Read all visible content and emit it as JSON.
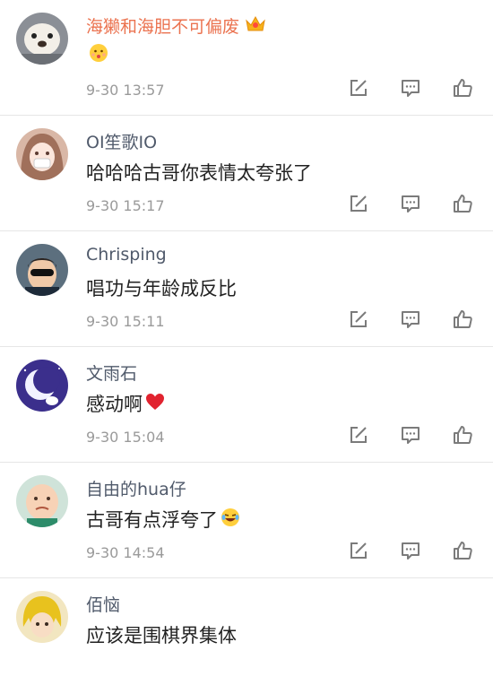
{
  "comments": [
    {
      "username": "海獭和海胆不可偏废",
      "vip": true,
      "text": "",
      "emoji": "kiss-emoji",
      "time": "9-30 13:57"
    },
    {
      "username": "OI笙歌IO",
      "vip": false,
      "text": "哈哈哈古哥你表情太夸张了",
      "emoji": "",
      "time": "9-30 15:17"
    },
    {
      "username": "Chrisping",
      "vip": false,
      "text": "唱功与年龄成反比",
      "emoji": "",
      "time": "9-30 15:11"
    },
    {
      "username": "文雨石",
      "vip": false,
      "text": "感动啊",
      "emoji": "heart-emoji",
      "time": "9-30 15:04"
    },
    {
      "username": "自由的hua仔",
      "vip": false,
      "text": "古哥有点浮夸了",
      "emoji": "laugh-cry-emoji",
      "time": "9-30 14:54"
    },
    {
      "username": "佰恼",
      "vip": false,
      "text": "应该是围棋界集体",
      "emoji": "",
      "time": ""
    }
  ],
  "colors": {
    "vip_name": "#eb7350",
    "name": "#505a6b",
    "text": "#222222",
    "time": "#9a9a9a",
    "icon": "#7b7b7b"
  },
  "icons": {
    "repost": "repost-icon",
    "comment": "comment-icon",
    "like": "like-icon",
    "crown": "crown-icon"
  }
}
